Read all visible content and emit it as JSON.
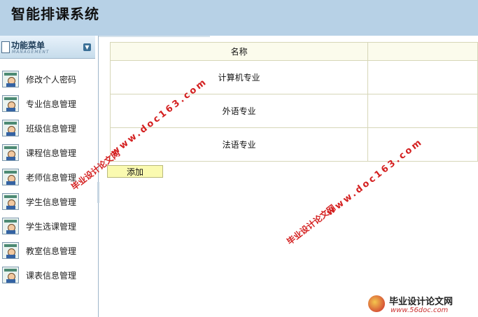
{
  "app": {
    "title": "智能排课系统"
  },
  "sidebar": {
    "title": "功能菜单",
    "subtitle": "MANAGEMENT",
    "items": [
      {
        "label": "修改个人密码"
      },
      {
        "label": "专业信息管理"
      },
      {
        "label": "班级信息管理"
      },
      {
        "label": "课程信息管理"
      },
      {
        "label": "老师信息管理"
      },
      {
        "label": "学生信息管理"
      },
      {
        "label": "学生选课管理"
      },
      {
        "label": "教室信息管理"
      },
      {
        "label": "课表信息管理"
      }
    ]
  },
  "table": {
    "columns": [
      "名称",
      ""
    ],
    "rows": [
      {
        "name": "计算机专业"
      },
      {
        "name": "外语专业"
      },
      {
        "name": "法语专业"
      }
    ]
  },
  "actions": {
    "add_label": "添加"
  },
  "watermark": {
    "text": "毕业设计论文网",
    "url": "www.doc163.com",
    "logo_text": "毕业设计论文网",
    "logo_url": "www.56doc.com"
  }
}
